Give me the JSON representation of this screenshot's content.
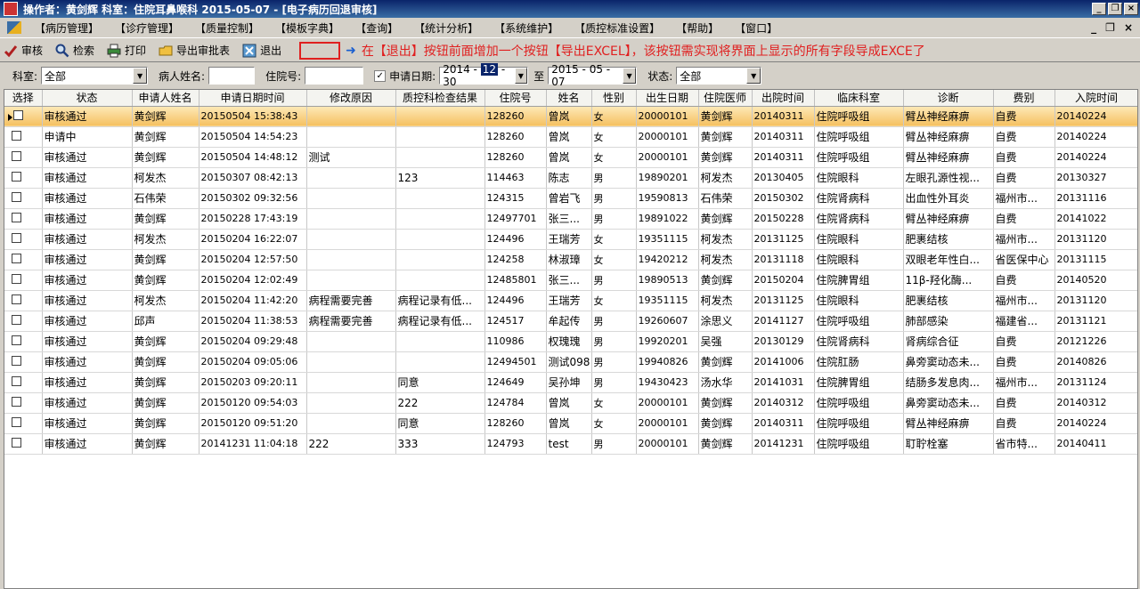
{
  "titlebar": {
    "title": "操作者：黄剑辉   科室：住院耳鼻喉科   2015-05-07 - [电子病历回退审核]",
    "min": "_",
    "restore": "❐",
    "close": "×"
  },
  "menubar": {
    "items": [
      "【病历管理】",
      "【诊疗管理】",
      "【质量控制】",
      "【模板字典】",
      "【查询】",
      "【统计分析】",
      "【系统维护】",
      "【质控标准设置】",
      "【帮助】",
      "【窗口】"
    ],
    "right": [
      "_",
      "❐",
      "×"
    ]
  },
  "toolbar": {
    "buttons": [
      {
        "label": "审核",
        "icon": "approve-icon"
      },
      {
        "label": "检索",
        "icon": "search-icon"
      },
      {
        "label": "打印",
        "icon": "printer-icon"
      },
      {
        "label": "导出审批表",
        "icon": "export-icon"
      },
      {
        "label": "退出",
        "icon": "exit-icon"
      }
    ],
    "annotation": "在【退出】按钮前面增加一个按钮【导出EXCEL】，该按钮需实现将界面上显示的所有字段导成EXCE了"
  },
  "filters": {
    "dept_label": "科室:",
    "dept_value": "全部",
    "patient_label": "病人姓名:",
    "patient_value": "",
    "inpatient_label": "住院号:",
    "inpatient_value": "",
    "date_label": "申请日期:",
    "date_from_y": "2014 -",
    "date_from_m": "12",
    "date_from_d": "- 30",
    "to_label": "至",
    "date_to": "2015 - 05 - 07",
    "status_label": "状态:",
    "status_value": "全部"
  },
  "columns": [
    "选择",
    "状态",
    "申请人姓名",
    "申请日期时间",
    "修改原因",
    "质控科检查结果",
    "住院号",
    "姓名",
    "性别",
    "出生日期",
    "住院医师",
    "出院时间",
    "临床科室",
    "诊断",
    "费别",
    "入院时间"
  ],
  "rows": [
    [
      "审核通过",
      "黄剑辉",
      "20150504 15:38:43",
      "",
      "",
      "128260",
      "曾岚",
      "女",
      "20000101",
      "黄剑辉",
      "20140311",
      "住院呼吸组",
      "臂丛神经麻痹",
      "自费",
      "20140224"
    ],
    [
      "申请中",
      "黄剑辉",
      "20150504 14:54:23",
      "",
      "",
      "128260",
      "曾岚",
      "女",
      "20000101",
      "黄剑辉",
      "20140311",
      "住院呼吸组",
      "臂丛神经麻痹",
      "自费",
      "20140224"
    ],
    [
      "审核通过",
      "黄剑辉",
      "20150504 14:48:12",
      "测试",
      "",
      "128260",
      "曾岚",
      "女",
      "20000101",
      "黄剑辉",
      "20140311",
      "住院呼吸组",
      "臂丛神经麻痹",
      "自费",
      "20140224"
    ],
    [
      "审核通过",
      "柯发杰",
      "20150307 08:42:13",
      "",
      "123",
      "114463",
      "陈志",
      "男",
      "19890201",
      "柯发杰",
      "20130405",
      "住院眼科",
      "左眼孔源性视...",
      "自费",
      "20130327"
    ],
    [
      "审核通过",
      "石伟荣",
      "20150302 09:32:56",
      "",
      "",
      "124315",
      "曾岩飞",
      "男",
      "19590813",
      "石伟荣",
      "20150302",
      "住院肾病科",
      "出血性外耳炎",
      "福州市...",
      "20131116"
    ],
    [
      "审核通过",
      "黄剑辉",
      "20150228 17:43:19",
      "",
      "",
      "12497701",
      "张三...",
      "男",
      "19891022",
      "黄剑辉",
      "20150228",
      "住院肾病科",
      "臂丛神经麻痹",
      "自费",
      "20141022"
    ],
    [
      "审核通过",
      "柯发杰",
      "20150204 16:22:07",
      "",
      "",
      "124496",
      "王瑞芳",
      "女",
      "19351115",
      "柯发杰",
      "20131125",
      "住院眼科",
      "肥裹结核",
      "福州市...",
      "20131120"
    ],
    [
      "审核通过",
      "黄剑辉",
      "20150204 12:57:50",
      "",
      "",
      "124258",
      "林淑璋",
      "女",
      "19420212",
      "柯发杰",
      "20131118",
      "住院眼科",
      "双眼老年性白...",
      "省医保中心",
      "20131115"
    ],
    [
      "审核通过",
      "黄剑辉",
      "20150204 12:02:49",
      "",
      "",
      "12485801",
      "张三...",
      "男",
      "19890513",
      "黄剑辉",
      "20150204",
      "住院脾胃组",
      "11β-羟化酶...",
      "自费",
      "20140520"
    ],
    [
      "审核通过",
      "柯发杰",
      "20150204 11:42:20",
      "病程需要完善",
      "病程记录有低...",
      "124496",
      "王瑞芳",
      "女",
      "19351115",
      "柯发杰",
      "20131125",
      "住院眼科",
      "肥裹结核",
      "福州市...",
      "20131120"
    ],
    [
      "审核通过",
      "邱声",
      "20150204 11:38:53",
      "病程需要完善",
      "病程记录有低...",
      "124517",
      "牟起传",
      "男",
      "19260607",
      "涂思义",
      "20141127",
      "住院呼吸组",
      "肺部感染",
      "福建省...",
      "20131121"
    ],
    [
      "审核通过",
      "黄剑辉",
      "20150204 09:29:48",
      "",
      "",
      "110986",
      "权瑰瑰",
      "男",
      "19920201",
      "吴强",
      "20130129",
      "住院肾病科",
      "肾病综合征",
      "自费",
      "20121226"
    ],
    [
      "审核通过",
      "黄剑辉",
      "20150204 09:05:06",
      "",
      "",
      "12494501",
      "测试098",
      "男",
      "19940826",
      "黄剑辉",
      "20141006",
      "住院肛肠",
      "鼻旁窦动态未...",
      "自费",
      "20140826"
    ],
    [
      "审核通过",
      "黄剑辉",
      "20150203 09:20:11",
      "",
      "同意",
      "124649",
      "吴孙坤",
      "男",
      "19430423",
      "汤水华",
      "20141031",
      "住院脾胃组",
      "结肠多发息肉...",
      "福州市...",
      "20131124"
    ],
    [
      "审核通过",
      "黄剑辉",
      "20150120 09:54:03",
      "",
      "222",
      "124784",
      "曾岚",
      "女",
      "20000101",
      "黄剑辉",
      "20140312",
      "住院呼吸组",
      "鼻旁窦动态未...",
      "自费",
      "20140312"
    ],
    [
      "审核通过",
      "黄剑辉",
      "20150120 09:51:20",
      "",
      "同意",
      "128260",
      "曾岚",
      "女",
      "20000101",
      "黄剑辉",
      "20140311",
      "住院呼吸组",
      "臂丛神经麻痹",
      "自费",
      "20140224"
    ],
    [
      "审核通过",
      "黄剑辉",
      "20141231 11:04:18",
      "222",
      "333",
      "124793",
      "test",
      "男",
      "20000101",
      "黄剑辉",
      "20141231",
      "住院呼吸组",
      "耵聍栓塞",
      "省市特...",
      "20140411"
    ]
  ]
}
